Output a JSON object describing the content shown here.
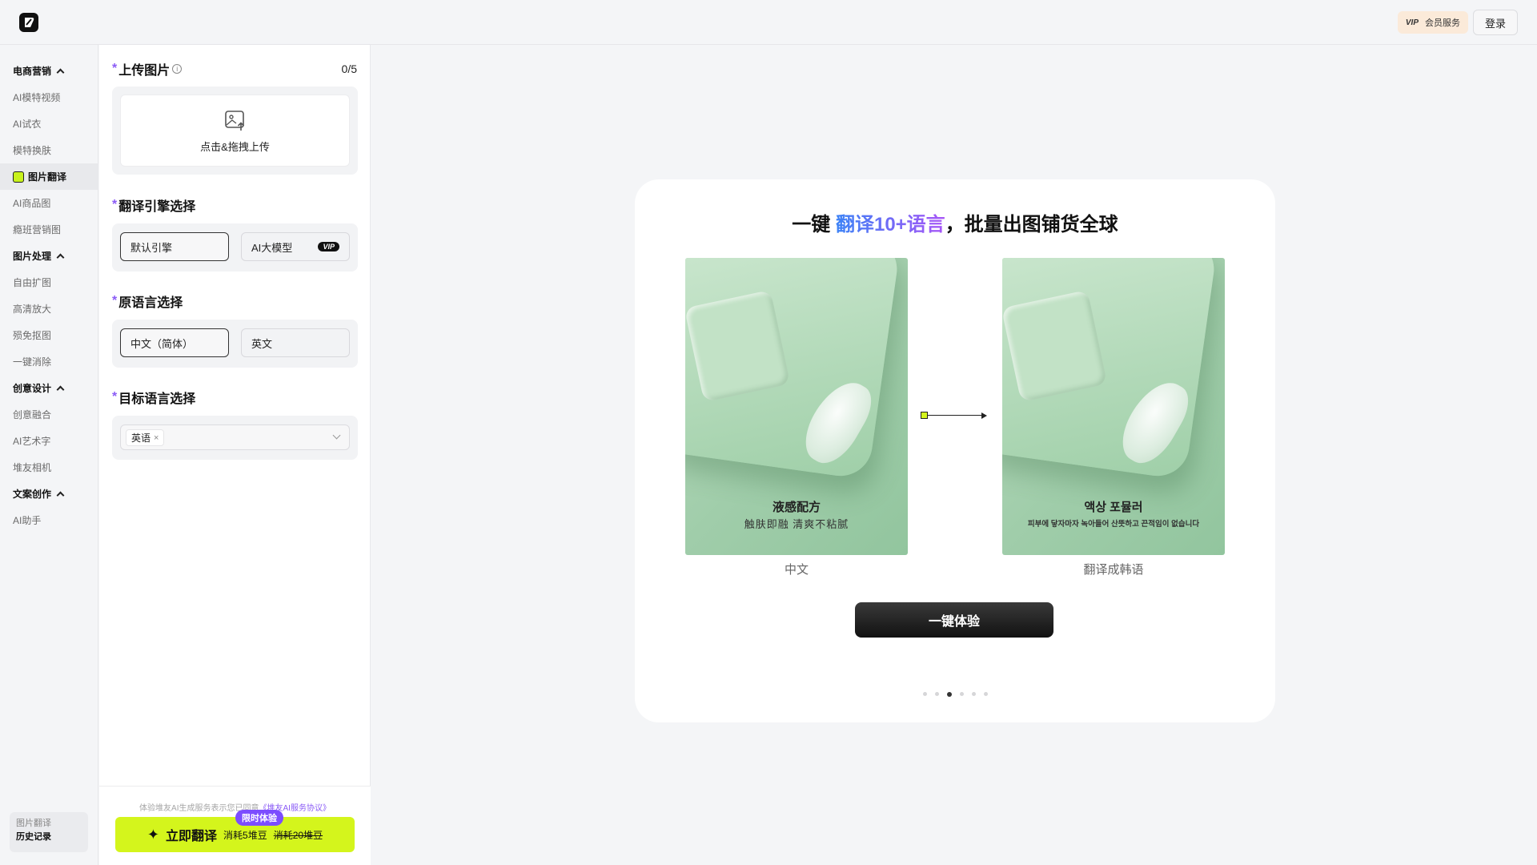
{
  "header": {
    "vip_mark": "VIP",
    "vip_label": "会员服务",
    "login_label": "登录"
  },
  "sidebar": {
    "groups": [
      {
        "title": "电商营销",
        "items": [
          "AI模特视频",
          "AI试衣",
          "模特换肤",
          "图片翻译",
          "AI商品图",
          "瘾班营销图"
        ]
      },
      {
        "title": "图片处理",
        "items": [
          "自由扩图",
          "高清放大",
          "殒免抠图",
          "一键消除"
        ]
      },
      {
        "title": "创意设计",
        "items": [
          "创意融合",
          "AI艺术字",
          "堆友相机"
        ]
      },
      {
        "title": "文案创作",
        "items": [
          "AI助手"
        ]
      }
    ],
    "history": {
      "line1": "图片翻译",
      "line2": "历史记录"
    }
  },
  "panel": {
    "upload": {
      "title": "上传图片",
      "info": "i",
      "count": "0/5",
      "upload_text": "点击&拖拽上传"
    },
    "engine": {
      "title": "翻译引擎选择",
      "option1": "默认引擎",
      "option2": "AI大模型",
      "vip": "VIP"
    },
    "source": {
      "title": "原语言选择",
      "option1": "中文（简体）",
      "option2": "英文"
    },
    "target": {
      "title": "目标语言选择",
      "tag": "英语",
      "tag_close": "×"
    },
    "required_mark": "*"
  },
  "footer": {
    "agree_prefix": "体验堆友AI生成服务表示您已同意",
    "agree_link": "《堆友AI服务协议》",
    "limited_badge": "限时体验",
    "cta_label": "立即翻译",
    "cta_cost": "消耗5堆豆",
    "cta_old_cost": "消耗20堆豆"
  },
  "showcase": {
    "title_prefix": "一键",
    "title_highlight": "翻译10+语言",
    "title_suffix": "，批量出图铺货全球",
    "left": {
      "caption1": "液感配方",
      "caption2": "触肤即融 清爽不粘腻",
      "label": "中文"
    },
    "right": {
      "caption1": "액상 포뮬러",
      "caption2": "피부에 닿자마자 녹아들어 산뜻하고 끈적임이 없습니다",
      "label": "翻译成韩语"
    },
    "try_button": "一键体验",
    "pagination": {
      "total": 6,
      "active_index": 2
    }
  },
  "colors": {
    "accent_lime": "#d4f51c",
    "accent_purple": "#8b5cf6",
    "vip_bg": "#fbead9"
  }
}
